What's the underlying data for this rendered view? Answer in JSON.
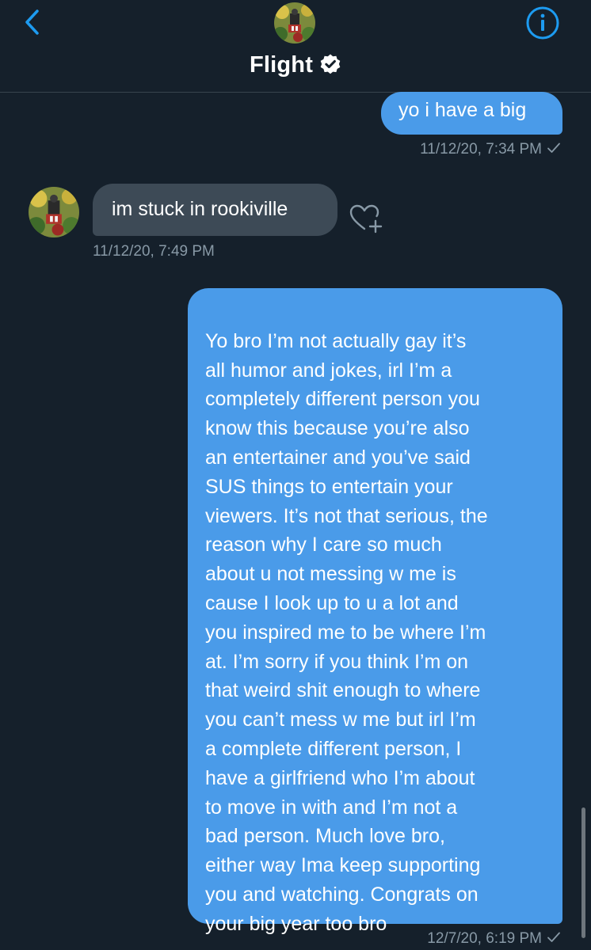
{
  "header": {
    "title": "Flight",
    "verified": true,
    "back_icon": "chevron-left-icon",
    "info_icon": "info-circle-icon"
  },
  "messages": [
    {
      "direction": "outgoing",
      "text": "yo i have a big",
      "timestamp": "11/12/20, 7:34 PM",
      "status": "sent-check"
    },
    {
      "direction": "incoming",
      "text": "im stuck in rookiville",
      "timestamp": "11/12/20, 7:49 PM",
      "reaction_icon": "heart-plus-icon"
    },
    {
      "direction": "outgoing",
      "text": "Yo bro I’m not actually gay it’s\nall humor and jokes, irl I’m a\ncompletely different person you\nknow this because you’re also\nan entertainer and you’ve  said\nSUS things to entertain your\nviewers. It’s not that serious, the\nreason why I care so much\nabout u not messing w me is\ncause I look up to u a lot and\nyou inspired me to be where I’m\nat. I’m sorry if you think I’m on\nthat weird shit enough to where\nyou can’t mess w me but irl I’m\na complete different person, I\nhave a girlfriend who I’m about\nto move in with and I’m not a\nbad person. Much love bro,\neither way Ima keep supporting\nyou and watching. Congrats on\nyour big year too bro",
      "timestamp": "12/7/20, 6:19 PM",
      "status": "sent-check"
    }
  ],
  "colors": {
    "background": "#15202b",
    "outgoing_bubble": "#4a9be9",
    "incoming_bubble": "#3d4a56",
    "accent": "#1d9bf0",
    "timestamp": "#8899a6"
  }
}
